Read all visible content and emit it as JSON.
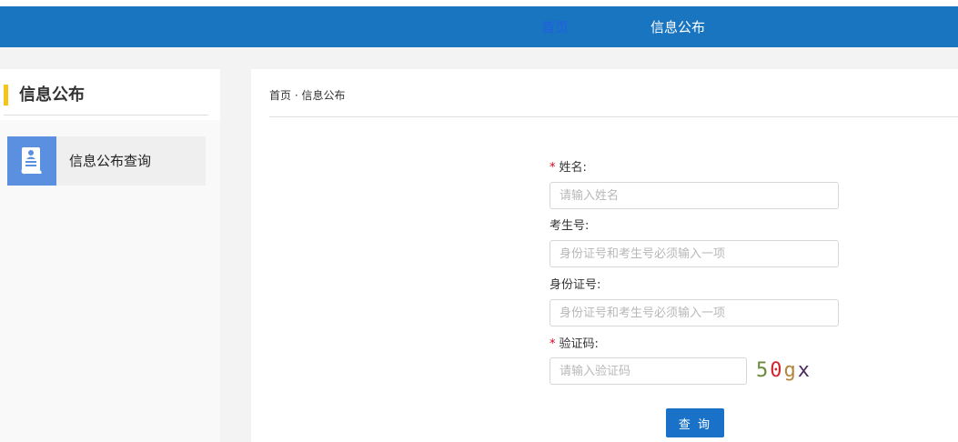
{
  "nav": {
    "items": [
      {
        "label": "首页"
      },
      {
        "label": "信息公布"
      }
    ]
  },
  "sidebar": {
    "title": "信息公布",
    "items": [
      {
        "label": "信息公布查询",
        "icon": "document-person-icon"
      }
    ]
  },
  "breadcrumb": {
    "text": "首页 · 信息公布"
  },
  "form": {
    "name": {
      "required_mark": "*",
      "label": "姓名:",
      "placeholder": "请输入姓名",
      "value": ""
    },
    "exam_no": {
      "label": "考生号:",
      "placeholder": "身份证号和考生号必须输入一项",
      "value": ""
    },
    "id_no": {
      "label": "身份证号:",
      "placeholder": "身份证号和考生号必须输入一项",
      "value": ""
    },
    "captcha": {
      "required_mark": "*",
      "label": "验证码:",
      "placeholder": "请输入验证码",
      "value": "",
      "chars": [
        {
          "ch": "5",
          "color": "#6b8a3a"
        },
        {
          "ch": "0",
          "color": "#d2232a"
        },
        {
          "ch": "g",
          "color": "#b5843a"
        },
        {
          "ch": "x",
          "color": "#4a2a5e"
        }
      ]
    },
    "submit_label": "查 询"
  },
  "colors": {
    "navbar": "#1a75c1",
    "accent": "#f5c518",
    "button": "#1a72c8",
    "required": "#d9001b"
  }
}
